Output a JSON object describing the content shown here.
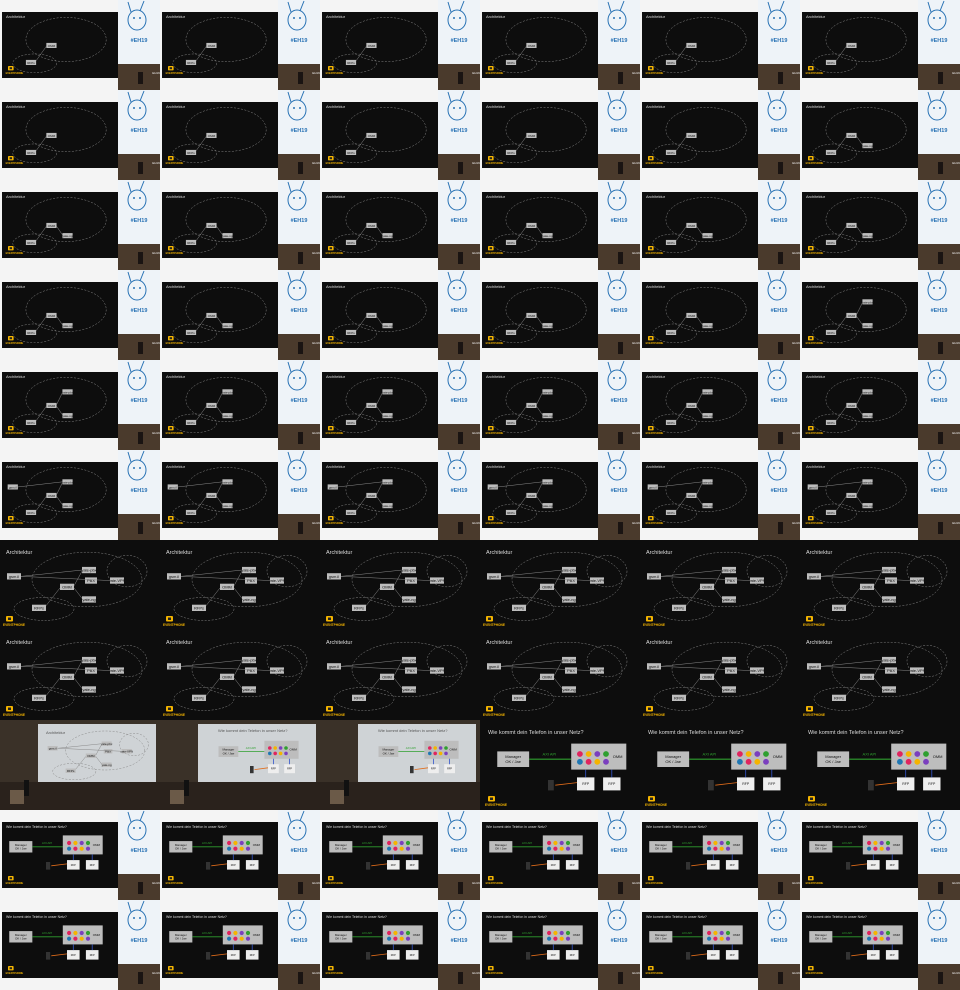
{
  "grid": {
    "columns": 6,
    "rows": 11
  },
  "slides": {
    "architecture_title": "Architektur",
    "phone_title": "Wie kommt dein Telefon in unser Netz?",
    "nodes": {
      "omm": "OMM",
      "rfps": "RFPs",
      "gsm": "gsm.il",
      "yate": "yate-ng",
      "voip": "yate-VPN",
      "pbx": "PBX",
      "pabx": "yate-pbx",
      "telco": "telco-bdtn"
    },
    "cloud_labels": {
      "eventphone": "Eventphone Netzwerk",
      "public": "Public Internet"
    },
    "phone_slide": {
      "manager": "Manager",
      "manager_sub": "OK / Jae",
      "axi": "AXI API",
      "omm_box": "OMM",
      "rfp": "RFP"
    },
    "logo": "EVENTPHONE",
    "hashtag": "#EH19",
    "bottom_tag": "EH19"
  },
  "frames": [
    {
      "kind": "arch_side",
      "step": 1
    },
    {
      "kind": "arch_side",
      "step": 1
    },
    {
      "kind": "arch_side",
      "step": 1
    },
    {
      "kind": "arch_side",
      "step": 1
    },
    {
      "kind": "arch_side",
      "step": 1
    },
    {
      "kind": "arch_side",
      "step": 1
    },
    {
      "kind": "arch_side",
      "step": 1
    },
    {
      "kind": "arch_side",
      "step": 1
    },
    {
      "kind": "arch_side",
      "step": 1
    },
    {
      "kind": "arch_side",
      "step": 1
    },
    {
      "kind": "arch_side",
      "step": 1
    },
    {
      "kind": "arch_side",
      "step": 2
    },
    {
      "kind": "arch_side",
      "step": 2
    },
    {
      "kind": "arch_side",
      "step": 2
    },
    {
      "kind": "arch_side",
      "step": 2
    },
    {
      "kind": "arch_side",
      "step": 2
    },
    {
      "kind": "arch_side",
      "step": 2
    },
    {
      "kind": "arch_side",
      "step": 2
    },
    {
      "kind": "arch_side",
      "step": 2
    },
    {
      "kind": "arch_side",
      "step": 2
    },
    {
      "kind": "arch_side",
      "step": 2
    },
    {
      "kind": "arch_side",
      "step": 2
    },
    {
      "kind": "arch_side",
      "step": 2
    },
    {
      "kind": "arch_side",
      "step": 3
    },
    {
      "kind": "arch_side",
      "step": 3
    },
    {
      "kind": "arch_side",
      "step": 3
    },
    {
      "kind": "arch_side",
      "step": 3
    },
    {
      "kind": "arch_side",
      "step": 3
    },
    {
      "kind": "arch_side",
      "step": 3
    },
    {
      "kind": "arch_side",
      "step": 3
    },
    {
      "kind": "arch_side",
      "step": 4
    },
    {
      "kind": "arch_side",
      "step": 4
    },
    {
      "kind": "arch_side",
      "step": 4
    },
    {
      "kind": "arch_side",
      "step": 4
    },
    {
      "kind": "arch_side",
      "step": 4
    },
    {
      "kind": "arch_side",
      "step": 4
    },
    {
      "kind": "arch_full",
      "step": 5
    },
    {
      "kind": "arch_full",
      "step": 5
    },
    {
      "kind": "arch_full",
      "step": 5
    },
    {
      "kind": "arch_full",
      "step": 5
    },
    {
      "kind": "arch_full",
      "step": 5
    },
    {
      "kind": "arch_full",
      "step": 5
    },
    {
      "kind": "arch_full",
      "step": 5
    },
    {
      "kind": "arch_full",
      "step": 5
    },
    {
      "kind": "arch_full",
      "step": 5
    },
    {
      "kind": "arch_full",
      "step": 5
    },
    {
      "kind": "arch_full",
      "step": 5
    },
    {
      "kind": "arch_full",
      "step": 5
    },
    {
      "kind": "room_arch",
      "step": 5
    },
    {
      "kind": "room_phone",
      "step": 0
    },
    {
      "kind": "room_phone",
      "step": 0
    },
    {
      "kind": "phone_full",
      "step": 0
    },
    {
      "kind": "phone_full",
      "step": 0
    },
    {
      "kind": "phone_full",
      "step": 0
    },
    {
      "kind": "phone_side",
      "step": 0
    },
    {
      "kind": "phone_side",
      "step": 0
    },
    {
      "kind": "phone_side",
      "step": 0
    },
    {
      "kind": "phone_side",
      "step": 0
    },
    {
      "kind": "phone_side",
      "step": 0
    },
    {
      "kind": "phone_side",
      "step": 0
    },
    {
      "kind": "phone_side",
      "step": 0
    },
    {
      "kind": "phone_side",
      "step": 0
    },
    {
      "kind": "phone_side",
      "step": 0
    },
    {
      "kind": "phone_side",
      "step": 0
    },
    {
      "kind": "phone_side",
      "step": 0
    },
    {
      "kind": "phone_side",
      "step": 0
    }
  ]
}
